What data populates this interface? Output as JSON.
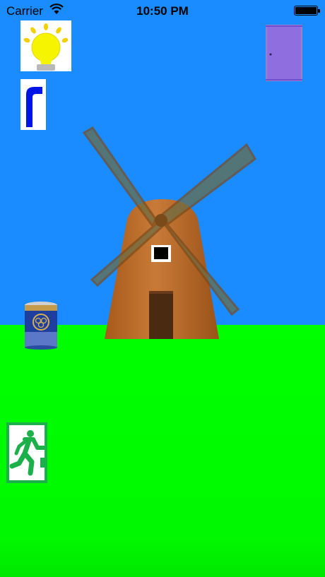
{
  "status_bar": {
    "carrier": "Carrier",
    "time": "10:50 PM",
    "wifi_icon": "wifi-icon",
    "battery_icon": "battery-icon"
  },
  "scene": {
    "sky_color": "#1a8cff",
    "grass_color": "#00ff00",
    "objects": [
      "light-bulb-icon",
      "bent-pipe-icon",
      "door-icon",
      "tea-canister-icon",
      "emergency-exit-icon",
      "windmill"
    ]
  }
}
